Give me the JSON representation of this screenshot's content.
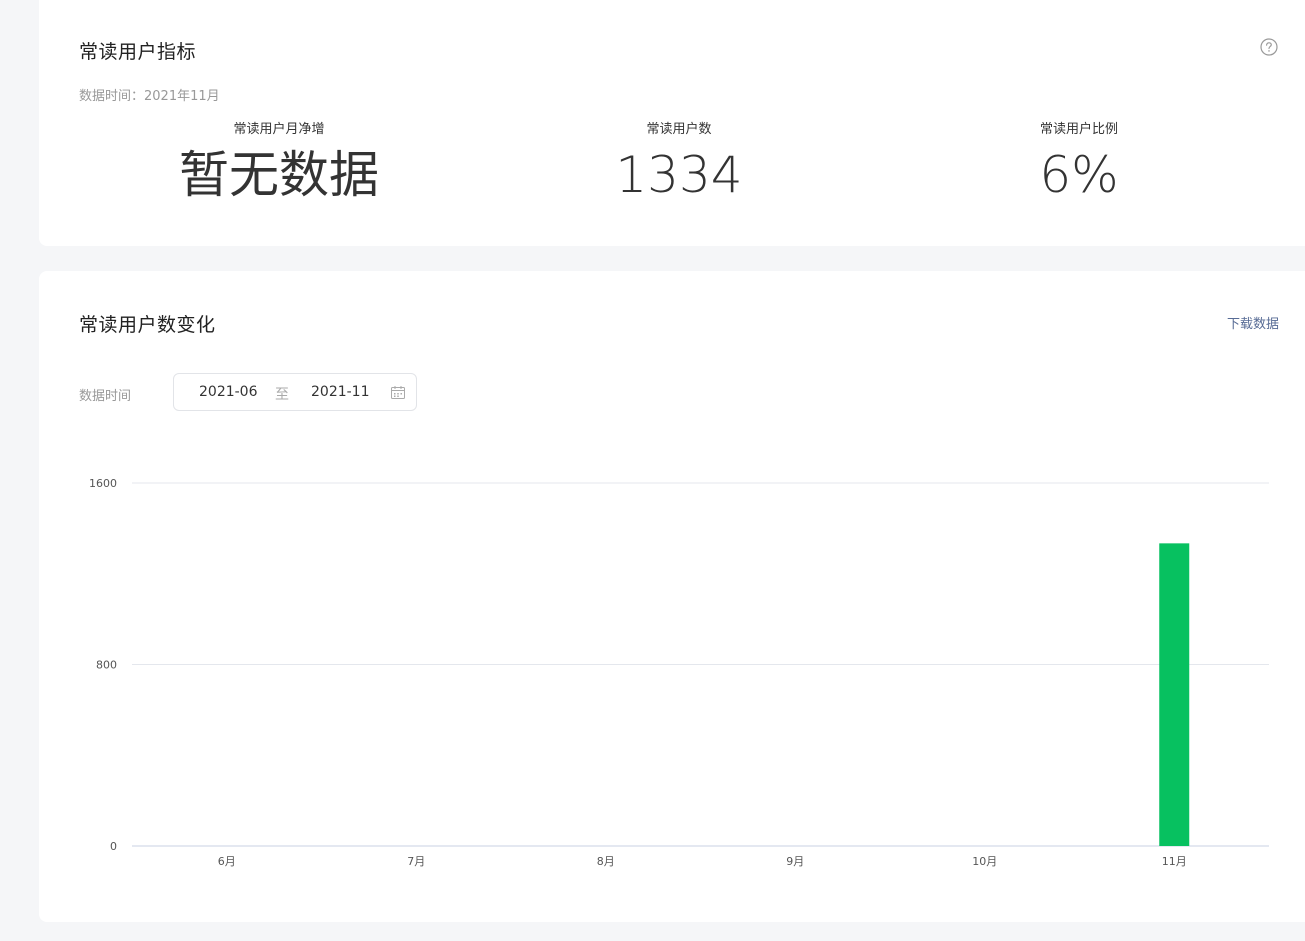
{
  "metrics_card": {
    "title": "常读用户指标",
    "data_time": "数据时间：2021年11月",
    "help_icon": "question-circle-icon",
    "metrics": [
      {
        "label": "常读用户月净增",
        "value": "暂无数据"
      },
      {
        "label": "常读用户数",
        "value": "1334"
      },
      {
        "label": "常读用户比例",
        "value": "6%"
      }
    ]
  },
  "trend_card": {
    "title": "常读用户数变化",
    "download_label": "下载数据",
    "filter_label": "数据时间",
    "date_range": {
      "start": "2021-06",
      "separator": "至",
      "end": "2021-11",
      "icon": "calendar-icon"
    }
  },
  "colors": {
    "bar": "#07c160",
    "grid": "#e4e7ed",
    "axis": "#c9d2e3",
    "link": "#576b95"
  },
  "chart_data": {
    "type": "bar",
    "categories": [
      "6月",
      "7月",
      "8月",
      "9月",
      "10月",
      "11月"
    ],
    "values": [
      0,
      0,
      0,
      0,
      0,
      1334
    ],
    "yticks": [
      0,
      800,
      1600
    ],
    "ylim": [
      0,
      1600
    ],
    "grid": true
  }
}
